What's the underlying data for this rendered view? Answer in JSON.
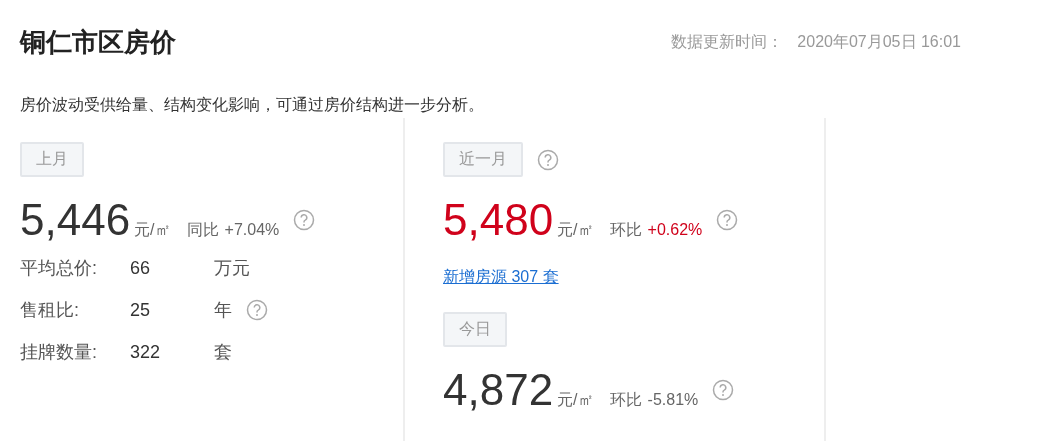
{
  "header": {
    "title": "铜仁市区房价",
    "update_label": "数据更新时间：",
    "update_time": "2020年07月05日 16:01"
  },
  "description": "房价波动受供给量、结构变化影响，可通过房价结构进一步分析。",
  "last_month": {
    "tag": "上月",
    "tag_help": false,
    "price": "5,446",
    "unit": "元/㎡",
    "change_label": "同比",
    "change_value": "+7.04%",
    "highlight": false,
    "help": true,
    "stats": [
      {
        "label": "平均总价:",
        "value": "66",
        "unit": "万元",
        "help": false
      },
      {
        "label": "售租比:",
        "value": "25",
        "unit": "年",
        "help": true
      },
      {
        "label": "挂牌数量:",
        "value": "322",
        "unit": "套",
        "help": false
      }
    ]
  },
  "recent": {
    "tag": "近一月",
    "tag_help": true,
    "price": "5,480",
    "unit": "元/㎡",
    "change_label": "环比",
    "change_value": "+0.62%",
    "highlight": true,
    "help": true,
    "link": "新增房源 307 套"
  },
  "today": {
    "tag": "今日",
    "tag_help": false,
    "price": "4,872",
    "unit": "元/㎡",
    "change_label": "环比",
    "change_value": "-5.81%",
    "highlight": false,
    "help": true
  }
}
